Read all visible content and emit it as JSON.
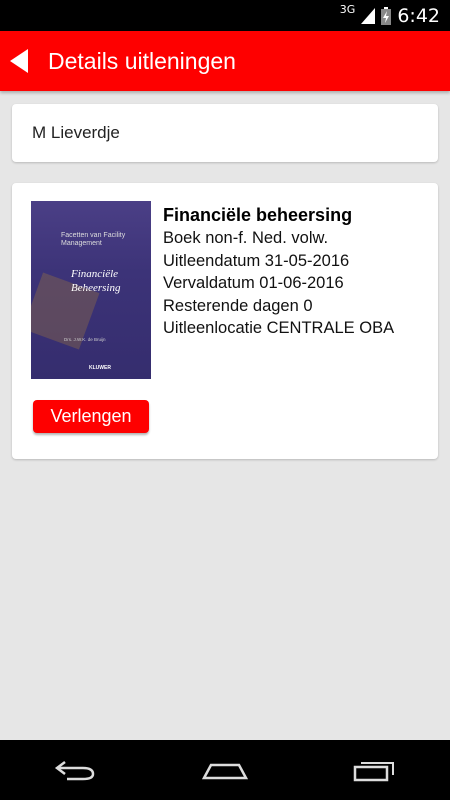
{
  "status_bar": {
    "network": "3G",
    "time": "6:42"
  },
  "app_bar": {
    "title": "Details uitleningen"
  },
  "user": {
    "name": "M Lieverdje"
  },
  "loan": {
    "title": "Financiële beheersing",
    "type": "Boek non-f. Ned. volw.",
    "loan_date": "Uitleendatum 31-05-2016",
    "due_date": "Vervaldatum 01-06-2016",
    "remaining": "Resterende dagen 0",
    "location": "Uitleenlocatie CENTRALE OBA",
    "cover": {
      "series": "Facetten van Facility Management",
      "title": "Financiële Beheersing",
      "author": "Drs. J.W.K. de Bruijn",
      "publisher": "KLUWER"
    },
    "renew_label": "Verlengen"
  },
  "colors": {
    "accent": "#fe0000",
    "background": "#e6e6e6",
    "card": "#ffffff"
  }
}
